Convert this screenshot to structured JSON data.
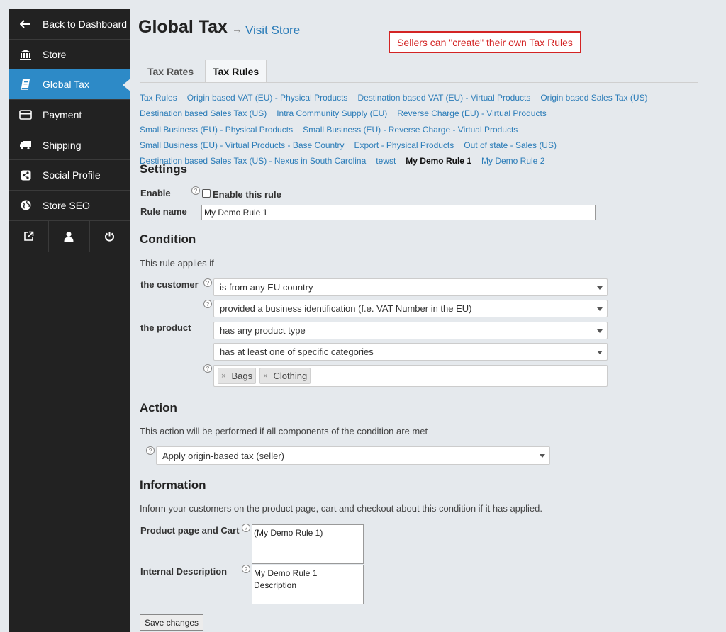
{
  "sidebar": {
    "items": [
      {
        "label": "Back to Dashboard",
        "icon": "arrow-left-icon"
      },
      {
        "label": "Store",
        "icon": "bank-icon"
      },
      {
        "label": "Global Tax",
        "icon": "book-icon"
      },
      {
        "label": "Payment",
        "icon": "credit-card-icon"
      },
      {
        "label": "Shipping",
        "icon": "truck-icon"
      },
      {
        "label": "Social Profile",
        "icon": "share-icon"
      },
      {
        "label": "Store SEO",
        "icon": "globe-icon"
      }
    ],
    "active_index": 2,
    "active_color": "#2d8ac7",
    "bottom_icons": [
      "external-link-icon",
      "user-icon",
      "power-icon"
    ]
  },
  "header": {
    "title": "Global Tax",
    "arrow": "→",
    "visit_store": "Visit Store",
    "notice": "Sellers can \"create\" their own Tax Rules"
  },
  "tabs": [
    {
      "label": "Tax Rates",
      "active": false
    },
    {
      "label": "Tax Rules",
      "active": true
    }
  ],
  "rule_links": [
    "Tax Rules",
    "Origin based VAT (EU) - Physical Products",
    "Destination based VAT (EU) - Virtual Products",
    "Origin based Sales Tax (US)",
    "Destination based Sales Tax (US)",
    "Intra Community Supply (EU)",
    "Reverse Charge (EU) - Virtual Products",
    "Small Business (EU) - Physical Products",
    "Small Business (EU) - Reverse Charge - Virtual Products",
    "Small Business (EU) - Virtual Products - Base Country",
    "Export - Physical Products",
    "Out of state - Sales (US)",
    "Destination based Sales Tax (US) - Nexus in South Carolina",
    "tewst",
    "My Demo Rule 1",
    "My Demo Rule 2"
  ],
  "current_rule": "My Demo Rule 1",
  "settings": {
    "heading": "Settings",
    "enable_label": "Enable",
    "enable_checkbox_label": "Enable this rule",
    "enabled": false,
    "rule_name_label": "Rule name",
    "rule_name_value": "My Demo Rule 1"
  },
  "condition": {
    "heading": "Condition",
    "intro": "This rule applies if",
    "customer_label": "the customer",
    "product_label": "the product",
    "customer_select_1": "is from any EU country",
    "customer_select_2": "provided a business identification (f.e. VAT Number in the EU)",
    "product_select_1": "has any product type",
    "product_select_2": "has at least one of specific categories",
    "categories": [
      "Bags",
      "Clothing"
    ],
    "tag_remove": "×"
  },
  "action": {
    "heading": "Action",
    "intro": "This action will be performed if all components of the condition are met",
    "select": "Apply origin-based tax (seller)"
  },
  "information": {
    "heading": "Information",
    "intro": "Inform your customers on the product page, cart and checkout about this condition if it has applied.",
    "product_page_label": "Product page and Cart",
    "product_page_value": "(My Demo Rule 1)",
    "internal_label": "Internal Description",
    "internal_value": "My Demo Rule 1\nDescription"
  },
  "save_label": "Save changes",
  "help_glyph": "?"
}
